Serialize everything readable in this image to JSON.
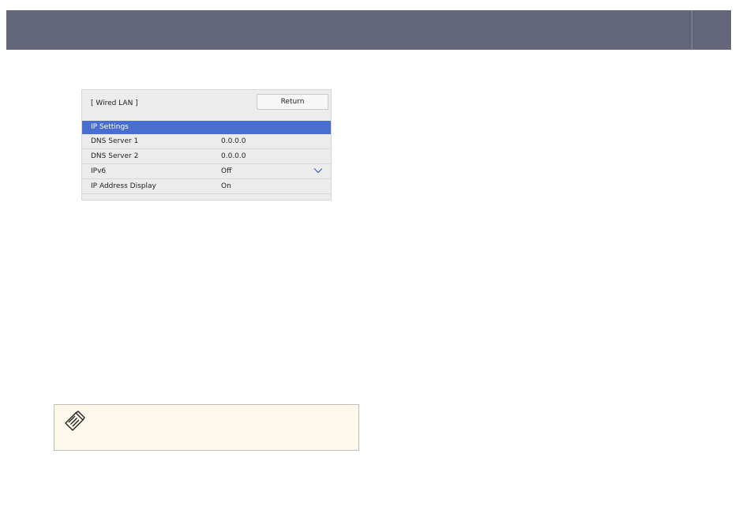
{
  "panel": {
    "title": "[ Wired LAN ]",
    "return_label": "Return",
    "rows": [
      {
        "label": "IP Settings",
        "value": ""
      },
      {
        "label": "DNS Server 1",
        "value": "0.0.0.0"
      },
      {
        "label": "DNS Server 2",
        "value": "0.0.0.0"
      },
      {
        "label": "IPv6",
        "value": "Off"
      },
      {
        "label": "IP Address Display",
        "value": "On"
      }
    ],
    "selected_row": "IP Settings"
  },
  "colors": {
    "header_bar": "#63667a",
    "selection": "#4a6ed0",
    "panel_background": "#ececec",
    "note_background": "#fdf8e9"
  },
  "icons": {
    "ipv6_dropdown": "chevron-down-icon",
    "note": "note-pencil-icon"
  }
}
